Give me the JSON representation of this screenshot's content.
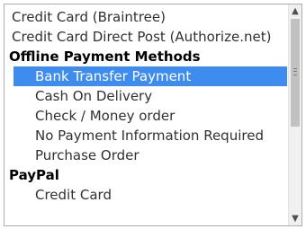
{
  "payment_methods": {
    "options": [
      {
        "label": "Credit Card (Braintree)"
      },
      {
        "label": "Credit Card Direct Post (Authorize.net)"
      }
    ],
    "groups": [
      {
        "label": "Offline Payment Methods",
        "options": [
          {
            "label": "Bank Transfer Payment",
            "selected": true
          },
          {
            "label": "Cash On Delivery"
          },
          {
            "label": "Check / Money order"
          },
          {
            "label": "No Payment Information Required"
          },
          {
            "label": "Purchase Order"
          }
        ]
      },
      {
        "label": "PayPal",
        "options": [
          {
            "label": "Credit Card"
          }
        ]
      }
    ]
  },
  "scrollbar": {
    "up_icon": "chevron-up-icon",
    "down_icon": "chevron-down-icon"
  }
}
